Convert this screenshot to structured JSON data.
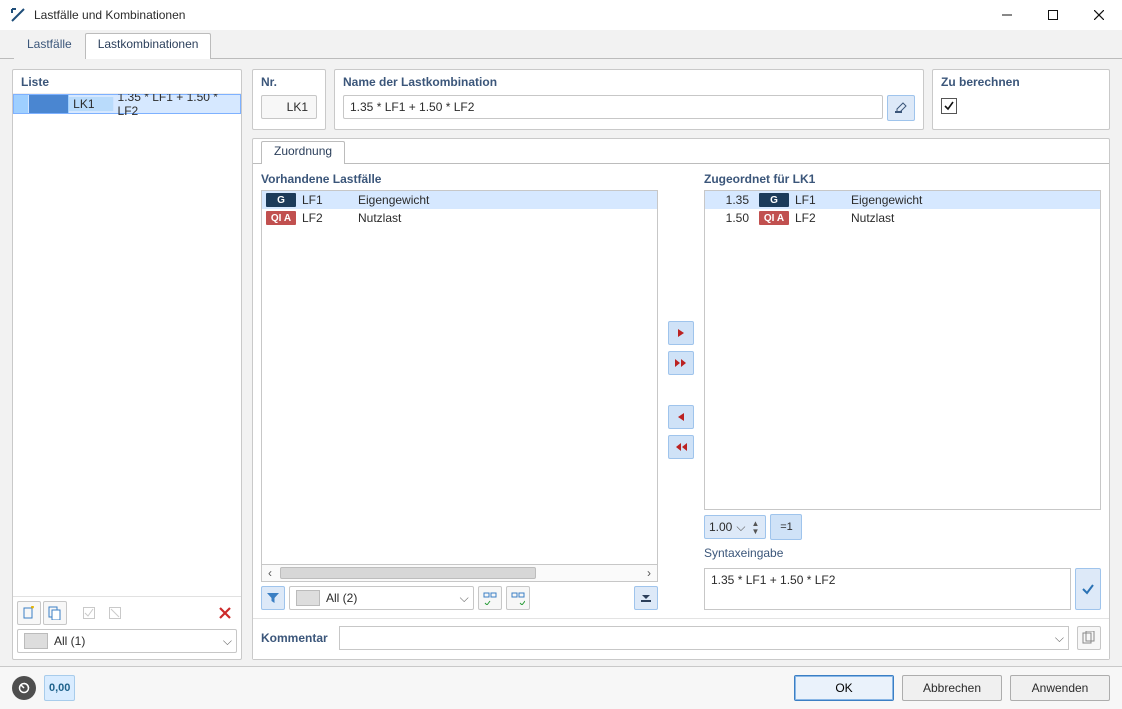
{
  "window": {
    "title": "Lastfälle und Kombinationen"
  },
  "tabs": {
    "items": [
      {
        "label": "Lastfälle"
      },
      {
        "label": "Lastkombinationen"
      }
    ]
  },
  "liste": {
    "header": "Liste",
    "rows": [
      {
        "id": "LK1",
        "name": "1.35 * LF1 + 1.50 * LF2"
      }
    ],
    "filter_label": "All (1)"
  },
  "header": {
    "nr_label": "Nr.",
    "nr_value": "LK1",
    "name_label": "Name der Lastkombination",
    "name_value": "1.35 * LF1 + 1.50 * LF2",
    "calc_label": "Zu berechnen",
    "calc_checked": true
  },
  "zuordnung": {
    "tab_label": "Zuordnung",
    "left": {
      "header": "Vorhandene Lastfälle",
      "rows": [
        {
          "badge": "G",
          "badge_kind": "g",
          "id": "LF1",
          "name": "Eigengewicht"
        },
        {
          "badge": "QI A",
          "badge_kind": "qia",
          "id": "LF2",
          "name": "Nutzlast"
        }
      ],
      "filter_label": "All (2)"
    },
    "right": {
      "header": "Zugeordnet für LK1",
      "rows": [
        {
          "factor": "1.35",
          "badge": "G",
          "badge_kind": "g",
          "id": "LF1",
          "name": "Eigengewicht"
        },
        {
          "factor": "1.50",
          "badge": "QI A",
          "badge_kind": "qia",
          "id": "LF2",
          "name": "Nutzlast"
        }
      ],
      "factor_value": "1.00",
      "equal_btn": "=1",
      "syntax_label": "Syntaxeingabe",
      "syntax_value": "1.35 * LF1 + 1.50 * LF2"
    }
  },
  "comment": {
    "label": "Kommentar"
  },
  "buttons": {
    "ok": "OK",
    "cancel": "Abbrechen",
    "apply": "Anwenden"
  },
  "bottom": {
    "digits": "0,00"
  }
}
